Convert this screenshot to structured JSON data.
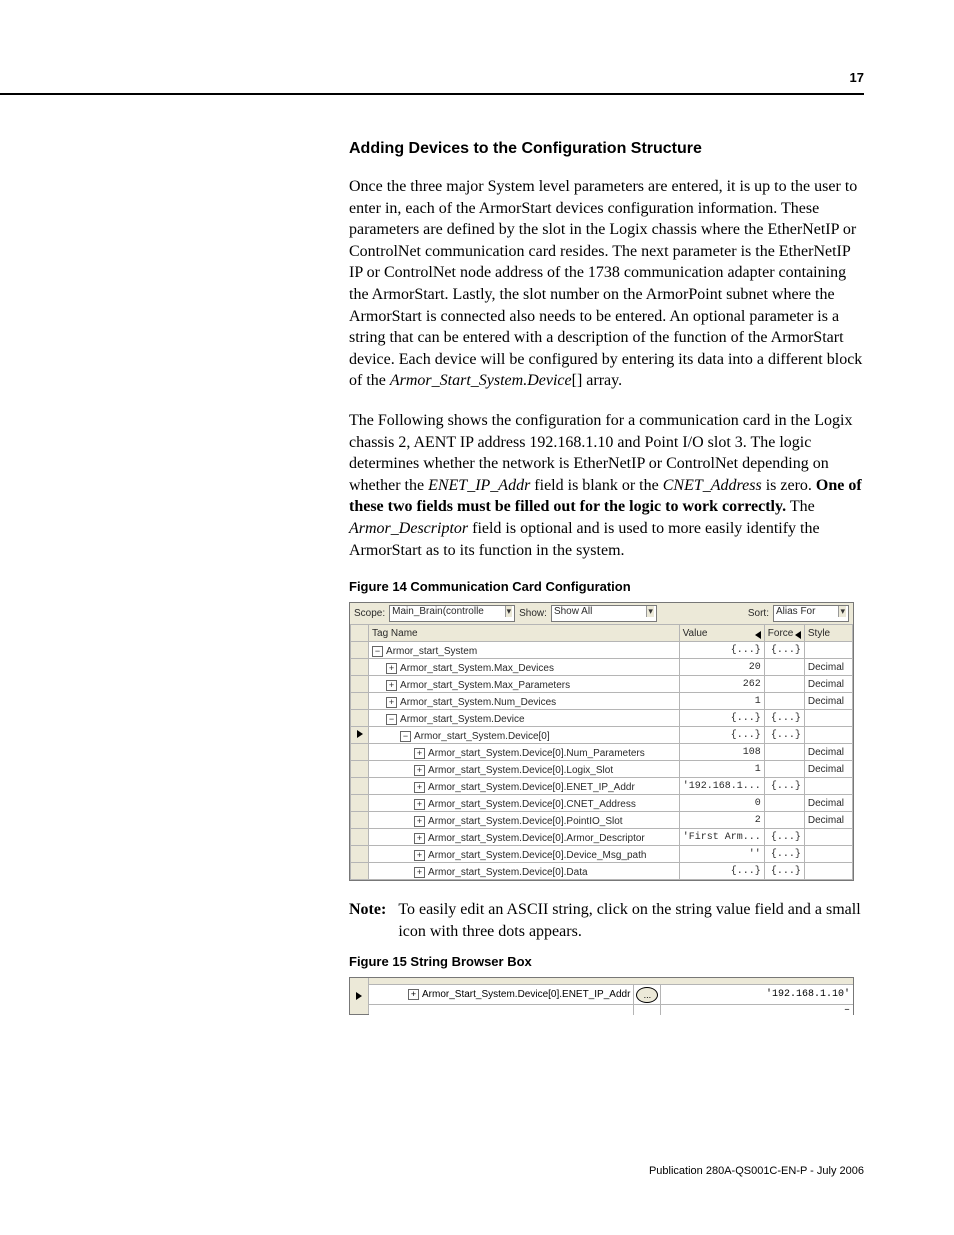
{
  "page_number": "17",
  "heading": "Adding Devices to the Configuration Structure",
  "para1": "Once the three major System level parameters are entered, it is up to the user to enter in, each of the ArmorStart devices configuration information. These parameters are defined by the slot in the Logix chassis where the EtherNetIP or ControlNet communication card resides. The next parameter is the EtherNetIP IP or ControlNet node address of the 1738 communication adapter containing the ArmorStart. Lastly, the slot number on the ArmorPoint subnet where the ArmorStart is connected also needs to be entered. An optional parameter is a string that can be entered with a description of the function of the ArmorStart device. Each device will be configured by entering its data into a different block of the ",
  "para1_it": "Armor_Start_System.Device",
  "para1_tail": "[] array.",
  "para2a": "The Following shows the configuration for a communication card in the Logix chassis 2, AENT IP address 192.168.1.10 and Point I/O slot 3. The logic determines whether the network is EtherNetIP or ControlNet depending on whether the ",
  "para2_it1": "ENET_IP_Addr",
  "para2b": " field is blank or the ",
  "para2_it2": "CNET_Address",
  "para2c": " is zero. ",
  "para2_bold": "One of these two fields must be filled out for the logic to work correctly.",
  "para2d": " The ",
  "para2_it3": "Armor_Descriptor",
  "para2e": " field is optional and is used to more easily identify the ArmorStart as to its function in the system.",
  "fig14_caption": "Figure 14 Communication Card Configuration",
  "toolbar": {
    "scope_label": "Scope:",
    "scope_value": "Main_Brain(controlle",
    "show_label": "Show:",
    "show_value": "Show All",
    "sort_label": "Sort:",
    "sort_value": "Alias For"
  },
  "grid": {
    "headers": {
      "name": "Tag Name",
      "value": "Value",
      "force": "Force",
      "style": "Style"
    },
    "rows": [
      {
        "indent": 0,
        "icon": "−",
        "name": "Armor_start_System",
        "value": "{...}",
        "force": "{...}",
        "style": ""
      },
      {
        "indent": 1,
        "icon": "+",
        "name": "Armor_start_System.Max_Devices",
        "value": "20",
        "force": "",
        "style": "Decimal"
      },
      {
        "indent": 1,
        "icon": "+",
        "name": "Armor_start_System.Max_Parameters",
        "value": "262",
        "force": "",
        "style": "Decimal"
      },
      {
        "indent": 1,
        "icon": "+",
        "name": "Armor_start_System.Num_Devices",
        "value": "1",
        "force": "",
        "style": "Decimal"
      },
      {
        "indent": 1,
        "icon": "−",
        "name": "Armor_start_System.Device",
        "value": "{...}",
        "force": "{...}",
        "style": ""
      },
      {
        "indent": 2,
        "icon": "−",
        "name": "Armor_start_System.Device[0]",
        "value": "{...}",
        "force": "{...}",
        "style": "",
        "selected": true
      },
      {
        "indent": 3,
        "icon": "+",
        "name": "Armor_start_System.Device[0].Num_Parameters",
        "value": "108",
        "force": "",
        "style": "Decimal"
      },
      {
        "indent": 3,
        "icon": "+",
        "name": "Armor_start_System.Device[0].Logix_Slot",
        "value": "1",
        "force": "",
        "style": "Decimal"
      },
      {
        "indent": 3,
        "icon": "+",
        "name": "Armor_start_System.Device[0].ENET_IP_Addr",
        "value": "'192.168.1...",
        "force": "{...}",
        "style": ""
      },
      {
        "indent": 3,
        "icon": "+",
        "name": "Armor_start_System.Device[0].CNET_Address",
        "value": "0",
        "force": "",
        "style": "Decimal"
      },
      {
        "indent": 3,
        "icon": "+",
        "name": "Armor_start_System.Device[0].PointIO_Slot",
        "value": "2",
        "force": "",
        "style": "Decimal"
      },
      {
        "indent": 3,
        "icon": "+",
        "name": "Armor_start_System.Device[0].Armor_Descriptor",
        "value": "'First Arm...",
        "force": "{...}",
        "style": ""
      },
      {
        "indent": 3,
        "icon": "+",
        "name": "Armor_start_System.Device[0].Device_Msg_path",
        "value": "''",
        "force": "{...}",
        "style": ""
      },
      {
        "indent": 3,
        "icon": "+",
        "name": "Armor_start_System.Device[0].Data",
        "value": "{...}",
        "force": "{...}",
        "style": ""
      }
    ]
  },
  "note_label": "Note:",
  "note_text": "To easily edit an ASCII string, click on the string value field and a small icon with three dots appears.",
  "fig15_caption": "Figure 15 String Browser Box",
  "string_browser": {
    "name": "Armor_Start_System.Device[0].ENET_IP_Addr",
    "button": "...",
    "value": "'192.168.1.10'"
  },
  "footer": "Publication 280A-QS001C-EN-P - July 2006"
}
